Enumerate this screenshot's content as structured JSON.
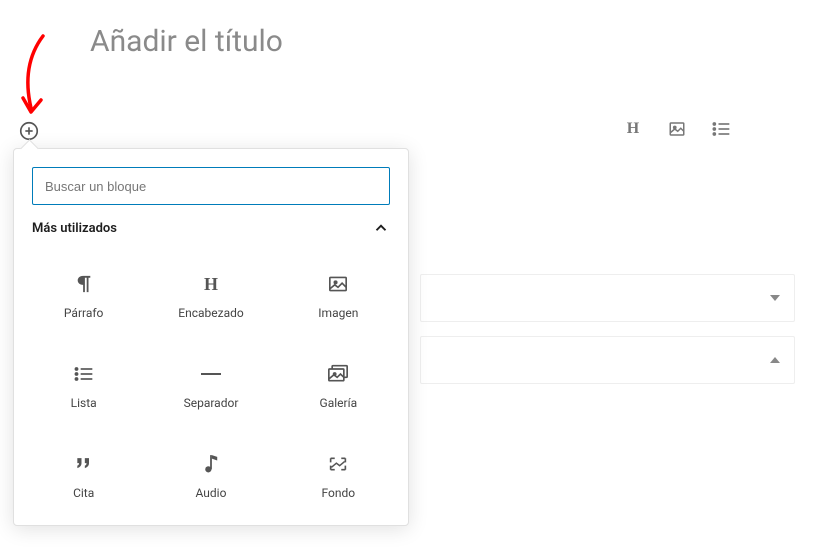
{
  "title": {
    "placeholder": "Añadir el título"
  },
  "search": {
    "placeholder": "Buscar un bloque"
  },
  "section": {
    "most_used": "Más utilizados"
  },
  "blocks": {
    "paragraph": "Párrafo",
    "heading": "Encabezado",
    "image": "Imagen",
    "list": "Lista",
    "separator": "Separador",
    "gallery": "Galería",
    "quote": "Cita",
    "audio": "Audio",
    "cover": "Fondo"
  },
  "toolbar": {
    "heading_icon": "H"
  }
}
